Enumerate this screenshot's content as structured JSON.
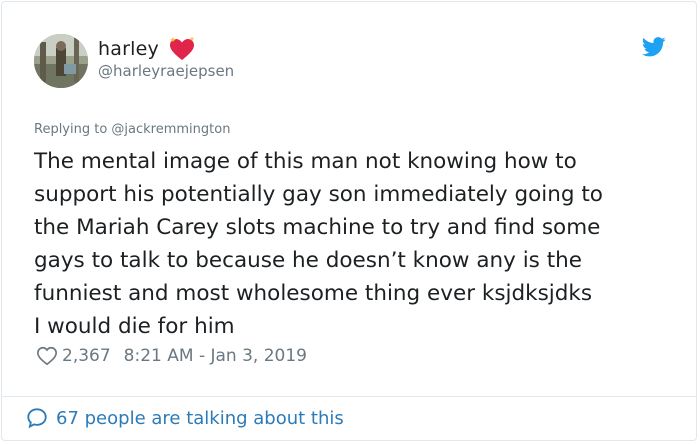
{
  "author": {
    "display_name": "harley",
    "handle": "@harleyraejepsen",
    "name_emoji": "heart-with-sparkles-icon",
    "avatar": "profile-photo"
  },
  "brand": {
    "icon": "twitter-bird-icon",
    "color": "#1da1f2"
  },
  "tweet": {
    "reply_context": "Replying to @jackremmington",
    "text": "The mental image of this man not knowing how to\nsupport his potentially gay son immediately going to\nthe Mariah Carey slots machine to try and find some\ngays to talk to because he doesn’t know any is the\nfunniest and most wholesome thing ever ksjdksjdks\nI would die for him",
    "like_icon": "heart-outline-icon",
    "like_count": "2,367",
    "timestamp": "8:21 AM - Jan 3, 2019"
  },
  "footer": {
    "icon": "speech-bubble-icon",
    "text": "67 people are talking about this",
    "color": "#2b7bb9"
  }
}
